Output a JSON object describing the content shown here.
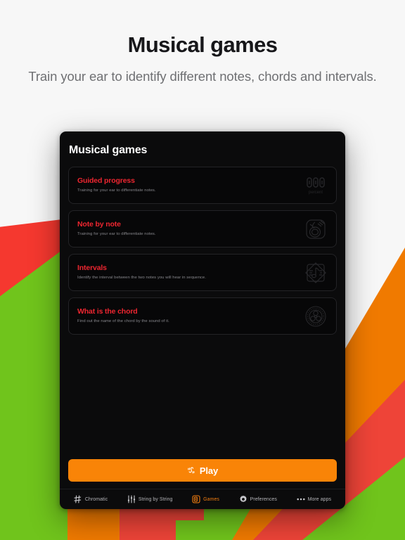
{
  "hero": {
    "title": "Musical games",
    "subtitle": "Train your ear to identify different notes, chords and intervals."
  },
  "app": {
    "title": "Musical games",
    "cards": [
      {
        "title": "Guided progress",
        "subtitle": "Training for your ear to differentiate notes.",
        "icon": "percent-digits-icon",
        "icon_label": "percent"
      },
      {
        "title": "Note by note",
        "subtitle": "Training for your ear to differentiate notes.",
        "icon": "note-circle-icon"
      },
      {
        "title": "Intervals",
        "subtitle": "Identify the interval between the two notes you will hear in sequence.",
        "icon": "interval-diamond-note-icon"
      },
      {
        "title": "What is the chord",
        "subtitle": "Find out the name of the chord by the sound of it.",
        "icon": "chord-circle-icon"
      }
    ],
    "play": {
      "label": "Play",
      "icon": "tuner-play-icon"
    },
    "nav": [
      {
        "label": "Chromatic",
        "icon": "sharp-icon",
        "active": false
      },
      {
        "label": "String by String",
        "icon": "strings-sliders-icon",
        "active": false
      },
      {
        "label": "Games",
        "icon": "games-card-icon",
        "active": true
      },
      {
        "label": "Preferences",
        "icon": "gear-icon",
        "active": false
      },
      {
        "label": "More apps",
        "icon": "more-dots-icon",
        "active": false
      }
    ]
  },
  "colors": {
    "accent_red": "#ee2630",
    "accent_orange": "#f98407",
    "bg_page": "#f7f7f7",
    "panel_bg": "#0b0b0c",
    "shape_red": "#f5382f",
    "shape_green": "#70c41c",
    "shape_orange": "#f07a00",
    "shape_red_soft": "#ee4438"
  }
}
